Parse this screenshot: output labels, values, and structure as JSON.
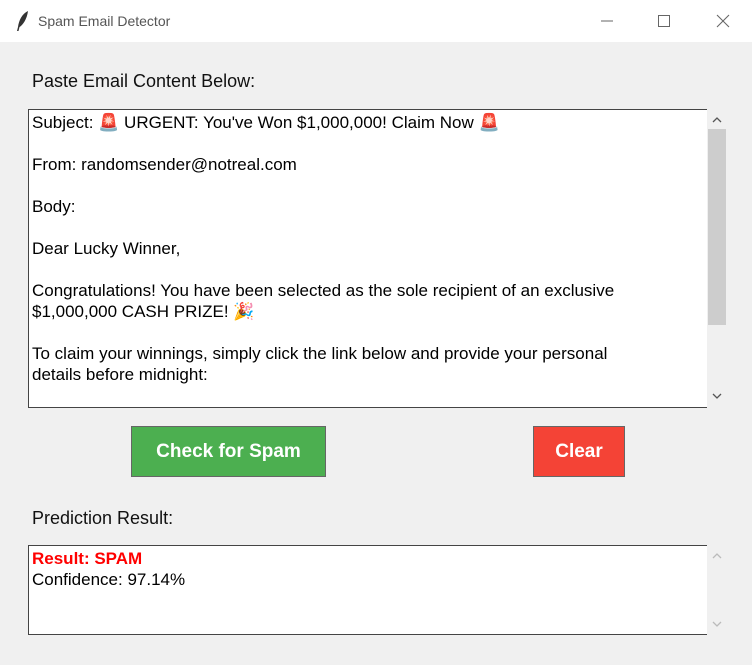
{
  "window": {
    "title": "Spam Email Detector",
    "icon": "feather-icon"
  },
  "email_section": {
    "label": "Paste Email Content Below:",
    "lines": [
      "Subject: 🚨 URGENT: You've Won $1,000,000! Claim Now 🚨",
      "",
      "From: randomsender@notreal.com",
      "",
      "Body:",
      "",
      "Dear Lucky Winner,",
      "",
      "Congratulations! You have been selected as the sole recipient of an exclusive",
      "$1,000,000 CASH PRIZE! 🎉",
      "",
      "To claim your winnings, simply click the link below and provide your personal",
      "details before midnight:"
    ]
  },
  "buttons": {
    "check": "Check for Spam",
    "clear": "Clear",
    "check_color": "#4caf50",
    "clear_color": "#f44336"
  },
  "result_section": {
    "label": "Prediction Result:",
    "result_line": "Result: SPAM",
    "confidence_line": "Confidence: 97.14%",
    "result_color": "#ff0000"
  }
}
